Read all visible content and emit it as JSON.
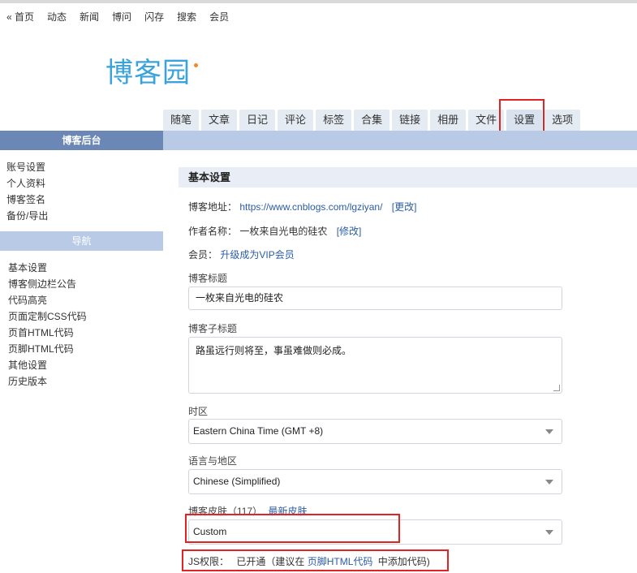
{
  "topnav": {
    "items": [
      "« 首页",
      "动态",
      "新闻",
      "博问",
      "闪存",
      "搜索",
      "会员"
    ]
  },
  "logo": {
    "text": "博客园",
    "color": "#3aa3dc",
    "accent": "#f08a24"
  },
  "tabs": {
    "items": [
      "随笔",
      "文章",
      "日记",
      "评论",
      "标签",
      "合集",
      "链接",
      "相册",
      "文件",
      "设置",
      "选项"
    ],
    "active": "设置"
  },
  "sidebar": {
    "title": "博客后台",
    "account_links": [
      "账号设置",
      "个人资料",
      "博客签名",
      "备份/导出"
    ],
    "nav_title": "导航",
    "nav_links": [
      "基本设置",
      "博客侧边栏公告",
      "代码高亮",
      "页面定制CSS代码",
      "页首HTML代码",
      "页脚HTML代码",
      "其他设置",
      "历史版本"
    ]
  },
  "settings": {
    "section_title": "基本设置",
    "blog_url_label": "博客地址：",
    "blog_url": "https://www.cnblogs.com/lgziyan/",
    "blog_url_action": "[更改]",
    "author_label": "作者名称：",
    "author_name": "一枚来自光电的硅农",
    "author_action": "[修改]",
    "member_label": "会员：",
    "member_action": "升级成为VIP会员",
    "title_label": "博客标题",
    "title_value": "一枚来自光电的硅农",
    "subtitle_label": "博客子标题",
    "subtitle_value": "路虽远行则将至，事虽难做则必成。",
    "timezone_label": "时区",
    "timezone_value": "Eastern China Time (GMT +8)",
    "locale_label": "语言与地区",
    "locale_value": "Chinese (Simplified)",
    "skin_label": "博客皮肤（117）",
    "skin_link": "最新皮肤",
    "skin_value": "Custom",
    "js_label": "JS权限：",
    "js_status": "已开通（建议在",
    "js_link": "页脚HTML代码",
    "js_suffix": "中添加代码)"
  },
  "colors": {
    "sidebar_header": "#6b87b6",
    "bar": "#b8cae6",
    "link": "#2a5ca8",
    "highlight": "#e02424"
  }
}
